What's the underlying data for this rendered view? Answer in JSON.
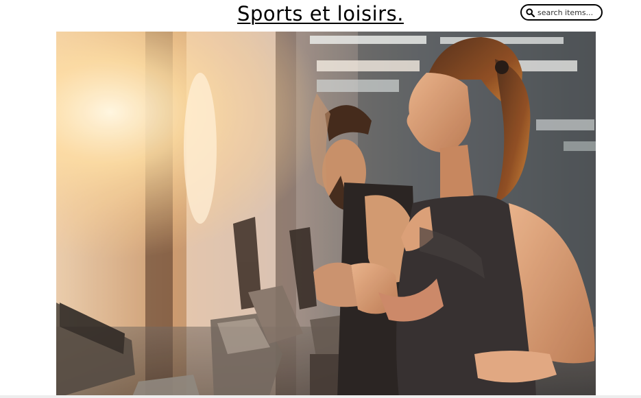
{
  "header": {
    "title": "Sports et loisirs."
  },
  "search": {
    "placeholder": "search items...",
    "icon": "search-icon"
  },
  "hero": {
    "icon": "photo-gym-treadmill-runners"
  },
  "colors": {
    "background": "#ffffff",
    "text": "#000000"
  }
}
